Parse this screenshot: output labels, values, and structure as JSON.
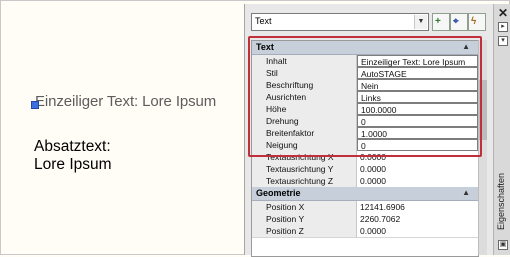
{
  "drawing": {
    "single_line_text": "Einzeiliger Text: Lore Ipsum",
    "mtext_line1": "Absatztext:",
    "mtext_line2": "Lore Ipsum"
  },
  "palette": {
    "title": "Eigenschaften",
    "object_type": "Text",
    "sections": [
      {
        "label": "Text",
        "rows": [
          {
            "name": "Inhalt",
            "value": "Einzeiliger Text: Lore Ipsum"
          },
          {
            "name": "Stil",
            "value": "AutoSTAGE"
          },
          {
            "name": "Beschriftung",
            "value": "Nein"
          },
          {
            "name": "Ausrichten",
            "value": "Links"
          },
          {
            "name": "Höhe",
            "value": "100.0000"
          },
          {
            "name": "Drehung",
            "value": "0"
          },
          {
            "name": "Breitenfaktor",
            "value": "1.0000"
          },
          {
            "name": "Neigung",
            "value": "0"
          },
          {
            "name": "Textausrichtung X",
            "value": "0.0000"
          },
          {
            "name": "Textausrichtung Y",
            "value": "0.0000"
          },
          {
            "name": "Textausrichtung Z",
            "value": "0.0000"
          }
        ]
      },
      {
        "label": "Geometrie",
        "rows": [
          {
            "name": "Position X",
            "value": "12141.6906"
          },
          {
            "name": "Position Y",
            "value": "2260.7062"
          },
          {
            "name": "Position Z",
            "value": "0.0000"
          }
        ]
      }
    ],
    "icons": [
      "toggle-pickadd-icon",
      "select-objects-icon",
      "quick-select-icon"
    ]
  }
}
